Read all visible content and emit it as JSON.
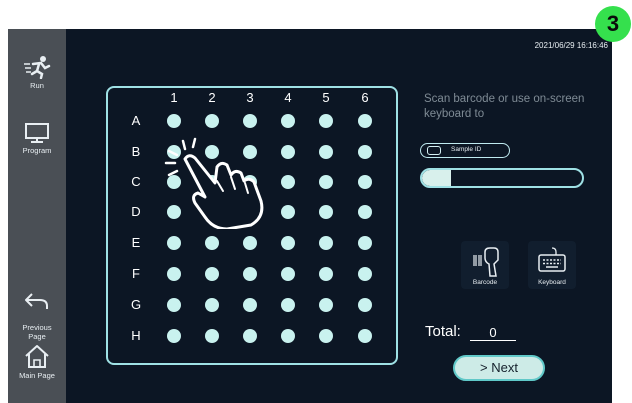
{
  "step_badge": "3",
  "timestamp": "2021/06/29  16:16:46",
  "sidebar": {
    "items": [
      {
        "id": "run",
        "label": "Run",
        "icon": "run-icon"
      },
      {
        "id": "program",
        "label": "Program",
        "icon": "monitor-icon"
      },
      {
        "id": "previous",
        "label": "Previous\nPage",
        "icon": "back-arrow-icon"
      },
      {
        "id": "main",
        "label": "Main Page",
        "icon": "home-icon"
      }
    ]
  },
  "plate": {
    "columns": [
      "1",
      "2",
      "3",
      "4",
      "5",
      "6"
    ],
    "rows": [
      "A",
      "B",
      "C",
      "D",
      "E",
      "F",
      "G",
      "H"
    ]
  },
  "instruction": "Scan barcode or use on-screen keyboard to",
  "sample_id": {
    "label": "Sample ID"
  },
  "progress": {
    "fraction": 0.18
  },
  "input_methods": [
    {
      "label": "Barcode",
      "icon": "barcode-scanner-icon"
    },
    {
      "label": "Keyboard",
      "icon": "keyboard-icon"
    }
  ],
  "total": {
    "label": "Total:",
    "value": "0"
  },
  "next_button": "> Next",
  "colors": {
    "accent": "#9fe1e5",
    "well": "#c9f2ef",
    "badge": "#35e04d",
    "screen_bg": "#0c1624",
    "sidebar_bg": "#4a4f55"
  }
}
